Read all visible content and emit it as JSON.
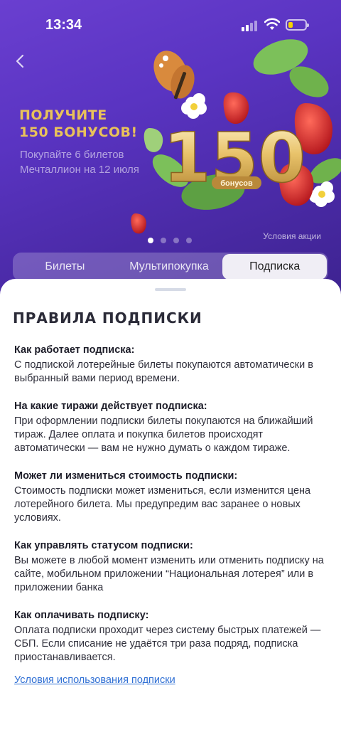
{
  "status_bar": {
    "time": "13:34"
  },
  "banner": {
    "title_line1": "ПОЛУЧИТЕ",
    "title_line2": "150 БОНУСОВ!",
    "subtitle_line1": "Покупайте 6 билетов",
    "subtitle_line2": "Мечталлион на 12 июля",
    "art_number": "150",
    "art_caption": "бонусов",
    "terms": "Условия акции",
    "slide_count": 4,
    "active_slide": 1
  },
  "tabs": [
    {
      "label": "Билеты",
      "active": false
    },
    {
      "label": "Мультипокупка",
      "active": false
    },
    {
      "label": "Подписка",
      "active": true
    }
  ],
  "sheet": {
    "title": "ПРАВИЛА ПОДПИСКИ",
    "items": [
      {
        "question": "Как работает подписка:",
        "answer": "С подпиской лотерейные билеты покупаются автоматически в выбранный вами период времени."
      },
      {
        "question": "На какие тиражи действует подписка:",
        "answer": "При оформлении подписки билеты покупаются на ближайший тираж. Далее оплата и покупка билетов происходят автоматически — вам не нужно думать о каждом тираже."
      },
      {
        "question": "Может ли измениться стоимость подписки:",
        "answer": "Стоимость подписки может измениться, если изменится цена лотерейного билета. Мы предупредим вас заранее о новых условиях."
      },
      {
        "question": "Как управлять статусом подписки:",
        "answer": "Вы можете в любой момент изменить или отменить подписку на сайте, мобильном приложении “Национальная лотерея” или в приложении банка"
      },
      {
        "question": "Как оплачивать подписку:",
        "answer": "Оплата подписки проходит через систему быстрых платежей — СБП. Если списание не удаётся три раза подряд, подписка приостанавливается."
      }
    ],
    "terms_link": "Условия использования подписки"
  },
  "icons": {
    "back": "chevron-left-icon",
    "signal": "cellular-signal-icon",
    "wifi": "wifi-icon",
    "battery": "battery-icon"
  },
  "colors": {
    "banner_bg": "#5a34c2",
    "promo_gold": "#e9c25a",
    "link": "#2f6fd4",
    "battery_fill": "#f5d300"
  }
}
